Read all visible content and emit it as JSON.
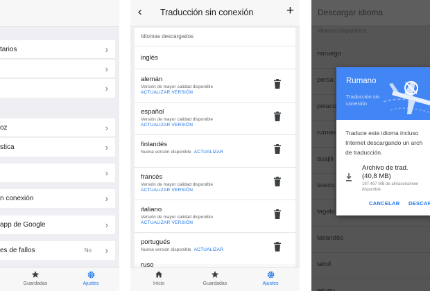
{
  "colors": {
    "accent": "#1a73e8",
    "dialog_header": "#4285f4",
    "overlay": "#555555"
  },
  "panel1": {
    "rows": [
      {
        "label": "tarios"
      },
      {
        "label": ""
      },
      {
        "label": ""
      },
      {
        "label": "oz"
      },
      {
        "label": "stica"
      },
      {
        "label": ""
      },
      {
        "label": "n conexión"
      },
      {
        "label": "app de Google"
      },
      {
        "label": "es de fallos",
        "value": "No"
      }
    ],
    "nav": [
      {
        "label": "Guardadas",
        "icon": "star-icon"
      },
      {
        "label": "Ajustes",
        "icon": "gear-icon"
      }
    ]
  },
  "panel2": {
    "title": "Traducción sin conexión",
    "section_header": "Idiomas descargados",
    "first_language": "inglés",
    "languages": [
      {
        "name": "alemán",
        "note": "Versión de mayor calidad disponible",
        "update": "ACTUALIZAR VERSIÓN"
      },
      {
        "name": "español",
        "note": "Versión de mayor calidad disponible",
        "update": "ACTUALIZAR VERSIÓN"
      },
      {
        "name": "finlandés",
        "note": "Nueva versión disponible",
        "update": "ACTUALIZAR"
      },
      {
        "name": "francés",
        "note": "Versión de mayor calidad disponible",
        "update": "ACTUALIZAR VERSIÓN"
      },
      {
        "name": "italiano",
        "note": "Versión de mayor calidad disponible",
        "update": "ACTUALIZAR VERSIÓN"
      },
      {
        "name": "portugués",
        "note": "Nueva versión disponible",
        "update": "ACTUALIZAR"
      },
      {
        "name": "ruso"
      }
    ],
    "nav": [
      {
        "label": "Inicio",
        "icon": "home-icon"
      },
      {
        "label": "Guardadas",
        "icon": "star-icon"
      },
      {
        "label": "Ajustes",
        "icon": "gear-icon"
      }
    ]
  },
  "panel3": {
    "title": "Descargar idioma",
    "subheader": "Idiomas disponibles",
    "languages": [
      "noruego",
      "persa",
      "polaco",
      "rumano",
      "suajili",
      "sueco",
      "tagalo",
      "tailandés",
      "tamil",
      "telugu"
    ],
    "dialog": {
      "title": "Rumano",
      "subtitle": "Traducción sin conexión",
      "body_lines": [
        "Traduce este idioma incluso",
        "Internet descargando un arch",
        "de traducción."
      ],
      "file_line1": "Archivo de trad.",
      "file_line2": "(40,8 MB)",
      "space_line1": "197.497 MB de almacenamien",
      "space_line2": "disponible",
      "cancel": "CANCELAR",
      "download": "DESCAR"
    }
  }
}
